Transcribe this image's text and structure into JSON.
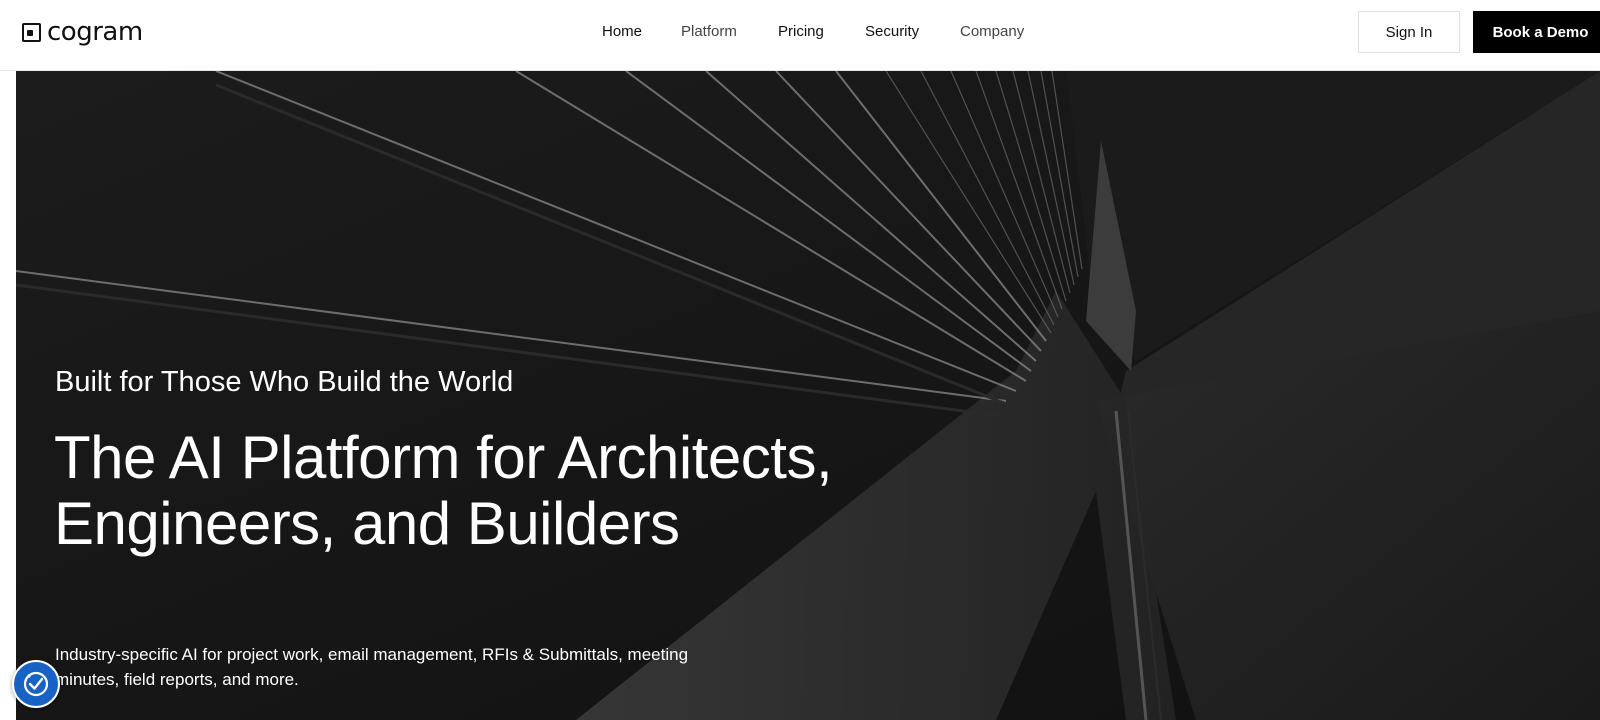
{
  "brand": {
    "name": "cogram"
  },
  "nav": {
    "items": [
      {
        "label": "Home"
      },
      {
        "label": "Platform"
      },
      {
        "label": "Pricing"
      },
      {
        "label": "Security"
      },
      {
        "label": "Company"
      }
    ],
    "sign_in_label": "Sign In",
    "book_demo_label": "Book a Demo"
  },
  "hero": {
    "eyebrow": "Built for Those Who Build the World",
    "title": "The AI Platform for Architects, Engineers, and Builders",
    "description": "Industry-specific AI for project work, email management, RFIs & Submittals, meeting minutes, field reports, and more."
  },
  "accessibility_widget": {
    "icon": "accessibility-check-icon",
    "color": "#1762c4"
  },
  "colors": {
    "header_bg": "#ffffff",
    "hero_bg": "#171717",
    "primary_button_bg": "#000000"
  }
}
